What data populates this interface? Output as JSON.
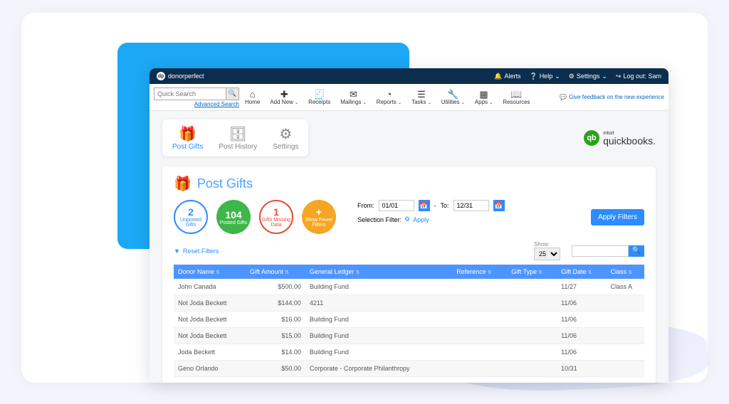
{
  "product": "donorperfect",
  "topbar": {
    "alerts": "Alerts",
    "help": "Help",
    "settings": "Settings",
    "logout": "Log out: Sam"
  },
  "nav": {
    "search_placeholder": "Quick Search",
    "advanced": "Advanced Search",
    "items": [
      {
        "icon": "⌂",
        "label": "Home"
      },
      {
        "icon": "✚",
        "label": "Add New",
        "chev": true
      },
      {
        "icon": "🧾",
        "label": "Receipts"
      },
      {
        "icon": "✉",
        "label": "Mailings",
        "chev": true
      },
      {
        "icon": "◔",
        "label": "Reports",
        "chev": true
      },
      {
        "icon": "☰",
        "label": "Tasks",
        "chev": true
      },
      {
        "icon": "🔧",
        "label": "Utilities",
        "chev": true
      },
      {
        "icon": "▦",
        "label": "Apps",
        "chev": true
      },
      {
        "icon": "📖",
        "label": "Resources"
      }
    ],
    "feedback": "Give feedback on the new experience"
  },
  "tabs": [
    {
      "icon": "🎁",
      "label": "Post Gifts",
      "active": true
    },
    {
      "icon": "🗄",
      "label": "Post History"
    },
    {
      "icon": "⚙",
      "label": "Settings"
    }
  ],
  "qb": {
    "intuit": "ıntuıt",
    "name": "quickbooks."
  },
  "page": {
    "title": "Post Gifts"
  },
  "stats": [
    {
      "num": "2",
      "label": "Unposted Gifts",
      "cls": "c-blue"
    },
    {
      "num": "104",
      "label": "Posted Gifts",
      "cls": "c-green"
    },
    {
      "num": "1",
      "label": "Gifts Missing Data",
      "cls": "c-red"
    },
    {
      "num": "+",
      "label": "Show Fewer Filters",
      "cls": "c-orange"
    }
  ],
  "filters": {
    "from_label": "From:",
    "from_value": "01/01",
    "to_label": "To:",
    "to_value": "12/31",
    "selection_label": "Selection Filter:",
    "apply_link": "Apply",
    "apply_btn": "Apply Filters",
    "reset": "Reset Filters",
    "show_label": "Show",
    "show_value": "25"
  },
  "table": {
    "headers": [
      "Donor Name",
      "Gift Amount",
      "General Ledger",
      "",
      "Reference",
      "Gift Type",
      "Gift Date",
      "Class"
    ],
    "rows": [
      {
        "donor": "John Canada",
        "amount": "$500.00",
        "ledger": "Building Fund",
        "ref": "",
        "type": "",
        "date": "11/27",
        "class": "Class A"
      },
      {
        "donor": "Not Joda Beckett",
        "amount": "$144.00",
        "ledger": "4211",
        "ref": "",
        "type": "",
        "date": "11/06",
        "class": ""
      },
      {
        "donor": "Not Joda Beckett",
        "amount": "$16.00",
        "ledger": "Building Fund",
        "ref": "",
        "type": "",
        "date": "11/06",
        "class": ""
      },
      {
        "donor": "Not Joda Beckett",
        "amount": "$15.00",
        "ledger": "Building Fund",
        "ref": "",
        "type": "",
        "date": "11/06",
        "class": ""
      },
      {
        "donor": "Joda Beckett",
        "amount": "$14.00",
        "ledger": "Building Fund",
        "ref": "",
        "type": "",
        "date": "11/06",
        "class": ""
      },
      {
        "donor": "Geno Orlando",
        "amount": "$50.00",
        "ledger": "Corporate - Corporate Philanthropy",
        "ref": "",
        "type": "",
        "date": "10/31",
        "class": ""
      }
    ]
  }
}
